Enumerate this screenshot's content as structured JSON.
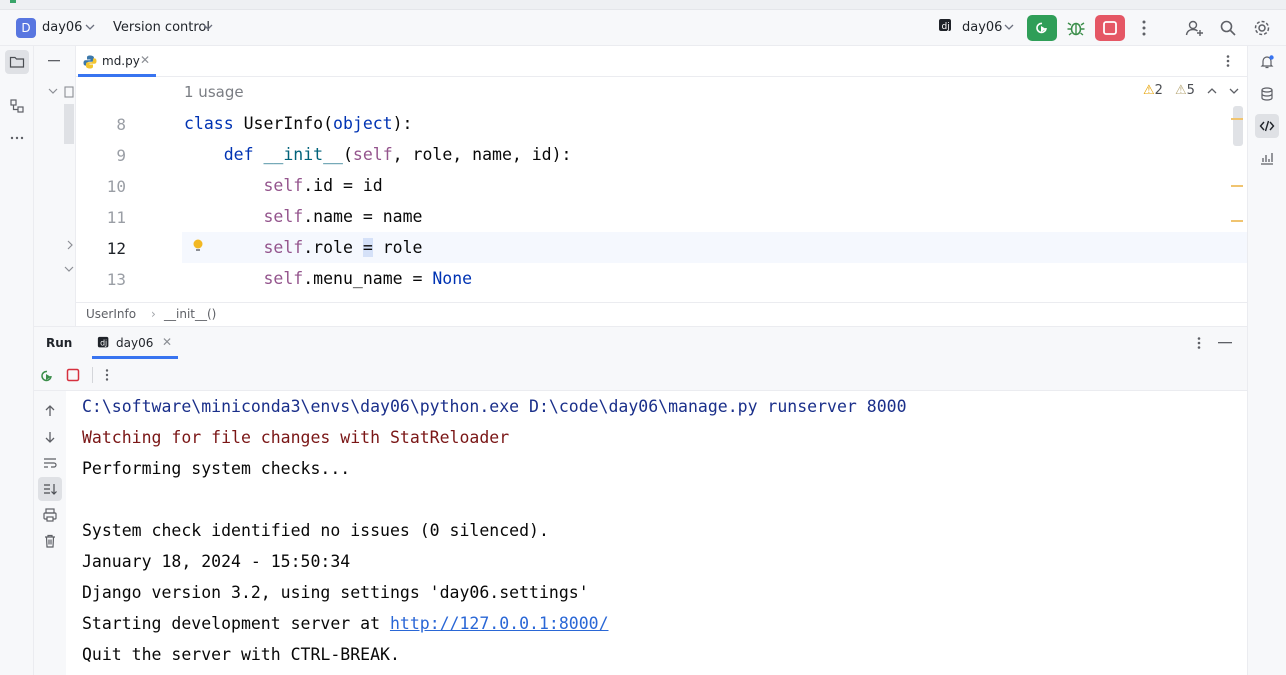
{
  "titlebar": {
    "project_badge": "D",
    "project_name": "day06",
    "vcs_label": "Version control",
    "run_config": "day06"
  },
  "editor": {
    "tab_label": "md.py",
    "usage_hint": "1 usage",
    "warnings_count": "2",
    "weak_warnings_count": "5",
    "line_numbers": [
      "8",
      "9",
      "10",
      "11",
      "12",
      "13"
    ],
    "breadcrumb": [
      "UserInfo",
      "__init__()"
    ]
  },
  "run_panel": {
    "title": "Run",
    "tab_label": "day06",
    "console": {
      "cmd": "C:\\software\\miniconda3\\envs\\day06\\python.exe D:\\code\\day06\\manage.py runserver 8000",
      "watching": "Watching for file changes with StatReloader",
      "checks": "Performing system checks...",
      "no_issues": "System check identified no issues (0 silenced).",
      "timestamp": "January 18, 2024 - 15:50:34",
      "django_version": "Django version 3.2, using settings 'day06.settings'",
      "starting_prefix": "Starting development server at ",
      "server_url": "http://127.0.0.1:8000/",
      "quit": "Quit the server with CTRL-BREAK."
    }
  },
  "colors": {
    "accent": "#3874f0",
    "run_green": "#2f9e58",
    "stop_red": "#e55765",
    "keyword": "#0033b3",
    "self": "#94558d"
  }
}
